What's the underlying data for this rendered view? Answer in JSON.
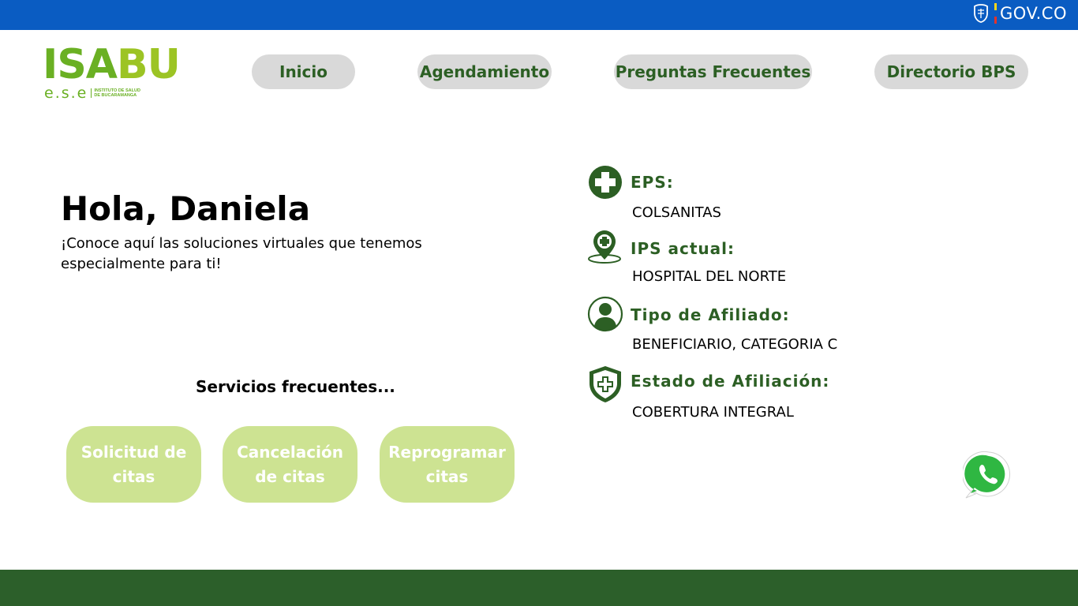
{
  "gov_bar": {
    "brand": "GOV.CO",
    "color": "#0a5cc2"
  },
  "logo": {
    "main_part1": "ISA",
    "main_part2": "BU",
    "sub": "e.s.e",
    "institute_line1": "INSTITUTO DE SALUD",
    "institute_line2": "DE BUCARAMANGA"
  },
  "nav": {
    "items": [
      {
        "label": "Inicio"
      },
      {
        "label": "Agendamiento"
      },
      {
        "label": "Preguntas Frecuentes"
      },
      {
        "label": "Directorio BPS"
      }
    ]
  },
  "main": {
    "greeting": "Hola, Daniela",
    "intro": "¡Conoce aquí las soluciones virtuales que tenemos especialmente para ti!",
    "services_title": "Servicios frecuentes...",
    "services": [
      {
        "label": "Solicitud de citas"
      },
      {
        "label": "Cancelación de citas"
      },
      {
        "label": "Reprogramar citas"
      }
    ]
  },
  "info": [
    {
      "label": "EPS:",
      "value": "COLSANITAS",
      "icon": "medical-cross-icon"
    },
    {
      "label": "IPS actual:",
      "value": "HOSPITAL DEL NORTE",
      "icon": "location-pin-icon"
    },
    {
      "label": "Tipo de Afiliado:",
      "value": "BENEFICIARIO, CATEGORIA C",
      "icon": "user-icon"
    },
    {
      "label": "Estado de Afiliación:",
      "value": "COBERTURA INTEGRAL",
      "icon": "shield-cross-icon"
    }
  ],
  "colors": {
    "accent": "#2c5f24",
    "service_button": "#cde392",
    "footer": "#2c5f2a",
    "logo_green": "#6ab023"
  }
}
